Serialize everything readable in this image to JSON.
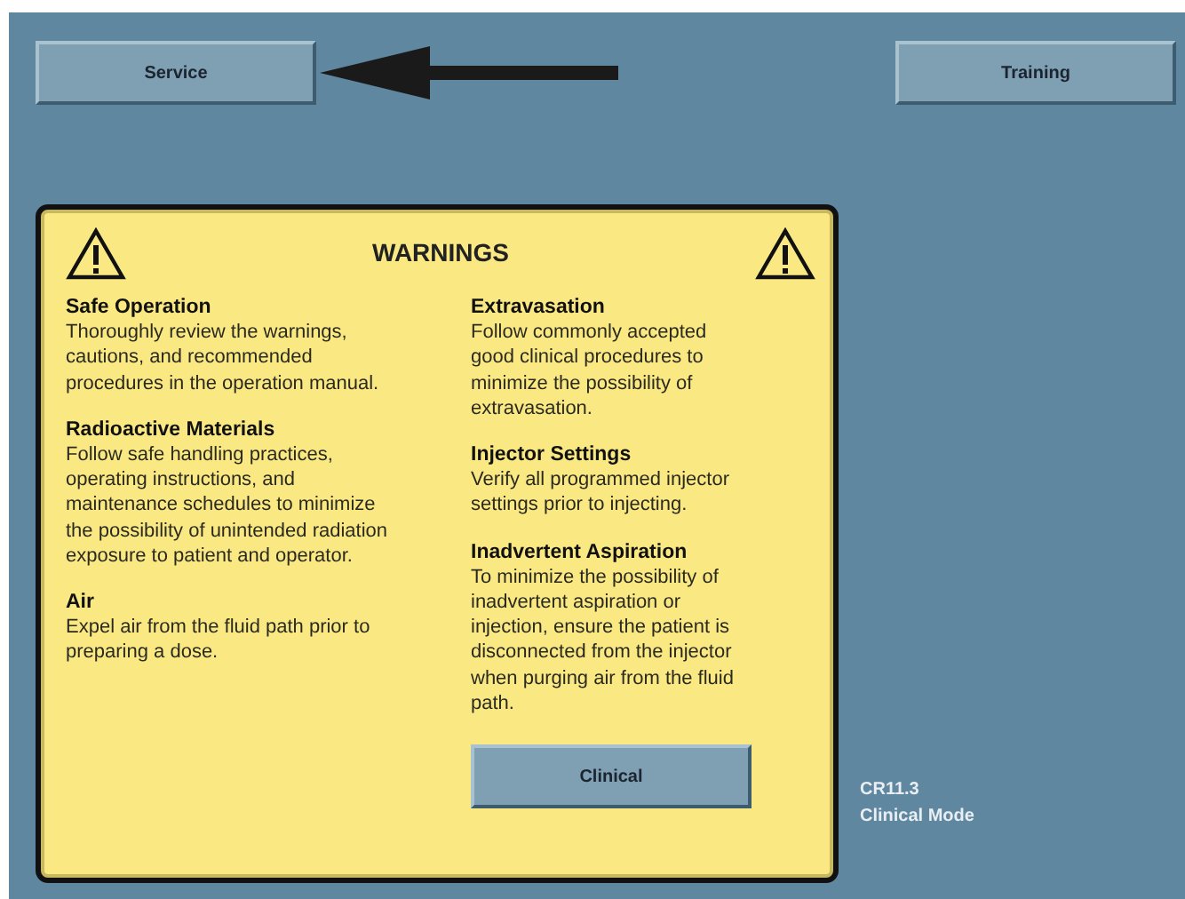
{
  "top_buttons": [
    {
      "label": "Service"
    },
    {
      "label": "Training"
    }
  ],
  "warnings": {
    "title": "WARNINGS",
    "columns": [
      [
        {
          "heading": "Safe Operation",
          "text": "Thoroughly review the warnings, cautions, and recommended procedures in the operation manual."
        },
        {
          "heading": "Radioactive Materials",
          "text": "Follow safe handling practices, operating instructions, and maintenance schedules to minimize the possibility of unintended radiation exposure to patient and operator."
        },
        {
          "heading": "Air",
          "text": "Expel air from the fluid path prior to preparing a dose."
        }
      ],
      [
        {
          "heading": "Extravasation",
          "text": "Follow commonly accepted good clinical procedures to minimize the possibility of extravasation."
        },
        {
          "heading": "Injector Settings",
          "text": "Verify all programmed injector settings prior to injecting."
        },
        {
          "heading": "Inadvertent Aspiration",
          "text": "To minimize the possibility of inadvertent aspiration or injection, ensure the patient is disconnected from the injector when purging air from the fluid path."
        }
      ]
    ],
    "button": "Clinical"
  },
  "status": {
    "version": "CR11.3",
    "mode": "Clinical Mode"
  }
}
